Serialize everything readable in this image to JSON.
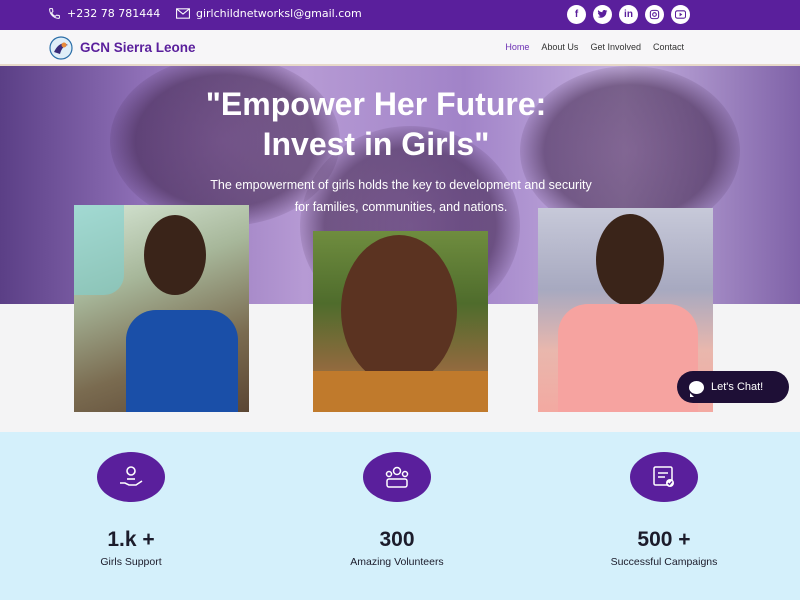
{
  "topbar": {
    "phone": "+232 78 781444",
    "email": "girlchildnetworksl@gmail.com",
    "socials": [
      "facebook-icon",
      "twitter-icon",
      "linkedin-icon",
      "instagram-icon",
      "youtube-icon"
    ],
    "color": "#5a1f9c"
  },
  "nav": {
    "brand": "GCN Sierra Leone",
    "items": [
      "Home",
      "About Us",
      "Get Involved",
      "Contact"
    ],
    "active": "Home"
  },
  "hero": {
    "title_line1": "\"Empower Her Future:",
    "title_line2": "Invest in Girls\"",
    "subtitle_line1": "The empowerment of girls holds the key to development and security",
    "subtitle_line2": "for families, communities, and nations."
  },
  "chat": {
    "label": "Let's Chat!"
  },
  "stats": [
    {
      "icon": "hand-support-icon",
      "value": "1.k +",
      "label": "Girls Support"
    },
    {
      "icon": "volunteers-icon",
      "value": "300",
      "label": "Amazing Volunteers"
    },
    {
      "icon": "campaign-certificate-icon",
      "value": "500 +",
      "label": "Successful Campaigns"
    }
  ]
}
